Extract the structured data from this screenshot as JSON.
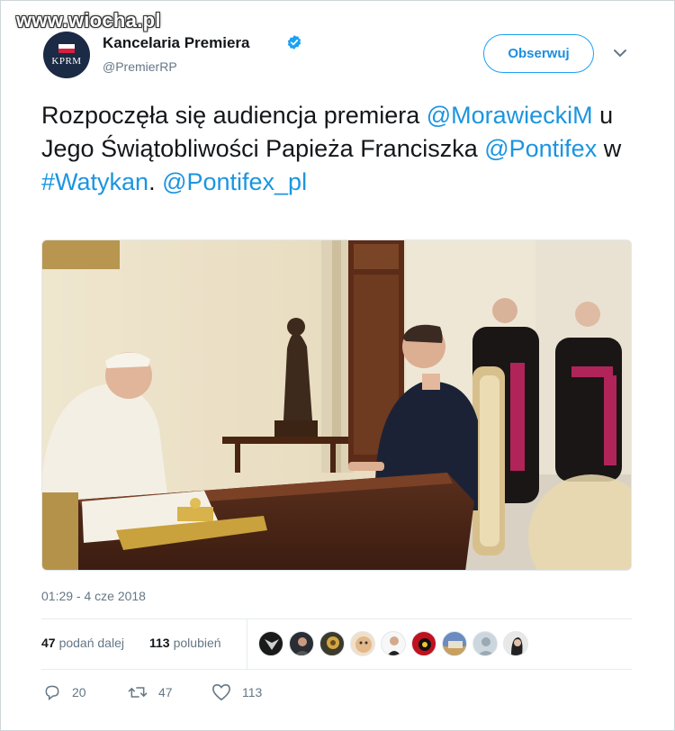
{
  "watermark": "www.wiocha.pl",
  "account": {
    "avatar_text": "KPRM",
    "name": "Kancelaria Premiera",
    "handle": "@PremierRP",
    "verified": true
  },
  "follow_label": "Obserwuj",
  "tweet": {
    "segments": [
      {
        "text": "Rozpoczęła się audiencja premiera ",
        "link": false
      },
      {
        "text": "@MorawieckiM",
        "link": true
      },
      {
        "text": " u Jego Świątobliwości Papieża Franciszka ",
        "link": false
      },
      {
        "text": "@Pontifex",
        "link": true
      },
      {
        "text": " w ",
        "link": false
      },
      {
        "text": "#Watykan",
        "link": true
      },
      {
        "text": ". ",
        "link": false
      },
      {
        "text": "@Pontifex_pl",
        "link": true
      }
    ]
  },
  "timestamp": "01:29 - 4 cze 2018",
  "stats": {
    "retweets": {
      "count": "47",
      "label": "podań dalej"
    },
    "likes": {
      "count": "113",
      "label": "polubień"
    }
  },
  "likers_count_shown": 9,
  "actions": {
    "replies": "20",
    "retweets": "47",
    "likes": "113"
  },
  "colors": {
    "link": "#1b95e0",
    "follow_border": "#1da1f2",
    "muted": "#657786",
    "avatar_bg": "#1b2a45"
  }
}
